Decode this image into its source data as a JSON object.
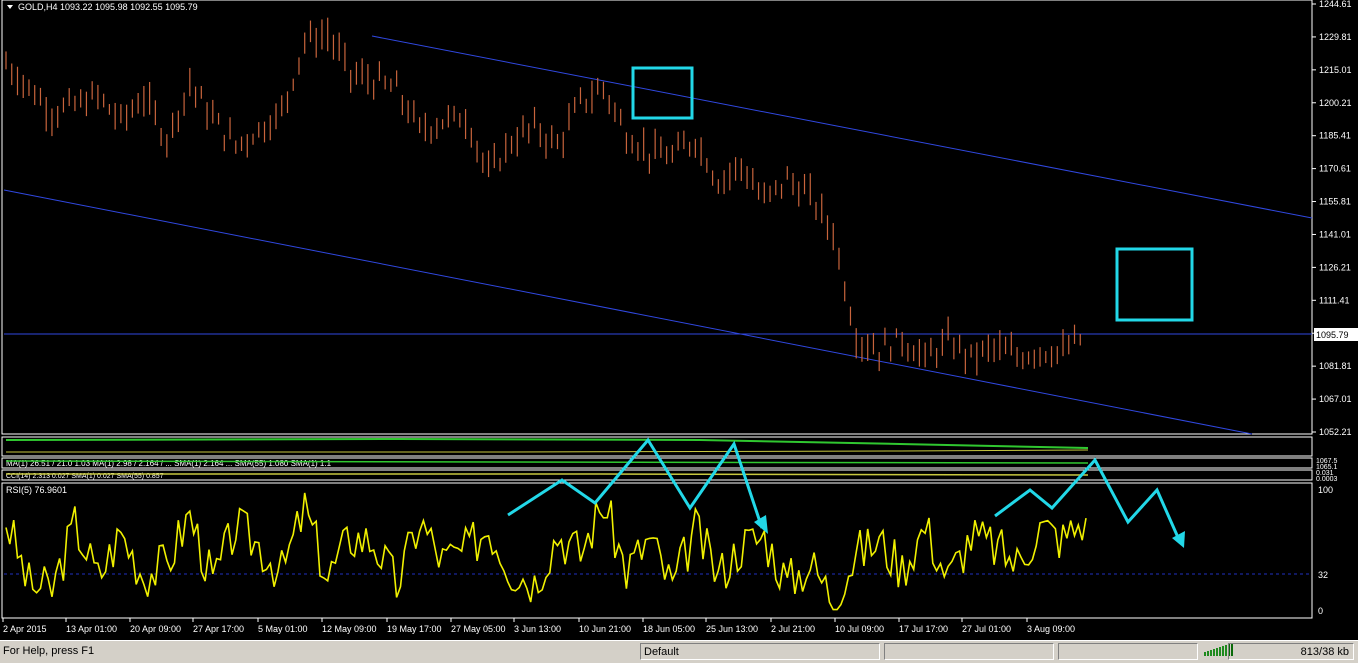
{
  "symbol_header": "GOLD,H4  1093.22 1095.98 1092.55 1095.79",
  "rsi_header": "RSI(5) 76.9601",
  "ma_header": "MA(1) 26.51 / 21.0 1.03  MA(1) 2.98 / 2.164 / ...  SMA(1) 2.164 ... SMA(55) 1.080  SMA(1) 1.1",
  "ma_header2": "CCI(14) 2.313 0.027  SMA(1) 0.027  SMA(55) 0.857",
  "indicator_values": [
    "1067.5",
    "1065.1",
    "0.031",
    "0.0003"
  ],
  "current_price_label": "1095.79",
  "colors": {
    "background": "#000000",
    "candles": "#c8643c",
    "trend_lines": "#3048e0",
    "annotation": "#22d8e8",
    "rsi": "#f0f000",
    "rsi_level": "#2030c0",
    "ma_green": "#30c830",
    "ma_yellow": "#c8c840"
  },
  "price_axis": {
    "labels": [
      "1244.61",
      "1229.81",
      "1215.01",
      "1200.21",
      "1185.41",
      "1170.61",
      "1155.81",
      "1141.01",
      "1126.21",
      "1111.41",
      "1096.61",
      "1081.81",
      "1067.01",
      "1052.21"
    ],
    "range": [
      1052.21,
      1244.61
    ]
  },
  "rsi_axis": {
    "labels": [
      "100",
      "32",
      "0"
    ],
    "level": 32
  },
  "time_axis": [
    "2 Apr 2015",
    "13 Apr 01:00",
    "20 Apr 09:00",
    "27 Apr 17:00",
    "5 May 01:00",
    "12 May 09:00",
    "19 May 17:00",
    "27 May 05:00",
    "3 Jun 13:00",
    "10 Jun 21:00",
    "18 Jun 05:00",
    "25 Jun 13:00",
    "2 Jul 21:00",
    "10 Jul 09:00",
    "17 Jul 17:00",
    "27 Jul 01:00",
    "3 Aug 09:00"
  ],
  "chart_data": {
    "type": "line",
    "title": "GOLD,H4",
    "x_unit": "H4 bar index",
    "ylim": [
      1052.21,
      1244.61
    ],
    "series": [
      {
        "name": "GOLD,H4",
        "x": [
          0,
          12,
          24,
          36,
          48,
          60,
          72,
          84,
          96,
          108,
          120,
          132,
          144,
          156,
          168,
          180,
          192,
          204,
          216,
          228,
          240,
          252,
          264,
          276,
          288,
          300,
          312,
          324,
          336,
          348,
          360,
          372,
          384,
          396,
          408,
          420,
          432,
          444,
          456,
          468,
          480,
          492,
          504,
          516,
          528,
          540,
          552,
          564
        ],
        "values": [
          1218,
          1207,
          1196,
          1199,
          1203,
          1192,
          1203,
          1184,
          1209,
          1193,
          1181,
          1188,
          1196,
          1228,
          1231,
          1213,
          1210,
          1206,
          1188,
          1192,
          1194,
          1168,
          1183,
          1189,
          1181,
          1200,
          1207,
          1186,
          1178,
          1176,
          1184,
          1165,
          1172,
          1156,
          1166,
          1158,
          1142,
          1095,
          1089,
          1094,
          1085,
          1093,
          1086,
          1090,
          1086,
          1089,
          1088,
          1096
        ]
      }
    ],
    "rsi": {
      "name": "RSI(5)",
      "ylim": [
        0,
        100
      ],
      "x": [
        0,
        12,
        24,
        36,
        48,
        60,
        72,
        84,
        96,
        108,
        120,
        132,
        144,
        156,
        168,
        180,
        192,
        204,
        216,
        228,
        240,
        252,
        264,
        276,
        288,
        300,
        312,
        324,
        336,
        348,
        360,
        372,
        384,
        396,
        408,
        420,
        432,
        444,
        456,
        468,
        480,
        492,
        504,
        516,
        528,
        540,
        552,
        564
      ],
      "values": [
        76,
        22,
        18,
        72,
        28,
        65,
        30,
        40,
        80,
        24,
        70,
        55,
        32,
        85,
        28,
        62,
        58,
        22,
        75,
        42,
        50,
        70,
        35,
        25,
        64,
        48,
        90,
        34,
        60,
        20,
        68,
        30,
        55,
        62,
        24,
        40,
        12,
        48,
        58,
        36,
        70,
        28,
        62,
        54,
        40,
        70,
        60,
        77
      ]
    }
  },
  "annotations": {
    "boxes": [
      "peak-box",
      "target-box"
    ],
    "arrows": [
      "zigzag-arrow-1",
      "zigzag-arrow-2"
    ]
  },
  "status_bar": {
    "help": "For Help, press F1",
    "profile": "Default",
    "traffic": "813/38 kb"
  }
}
